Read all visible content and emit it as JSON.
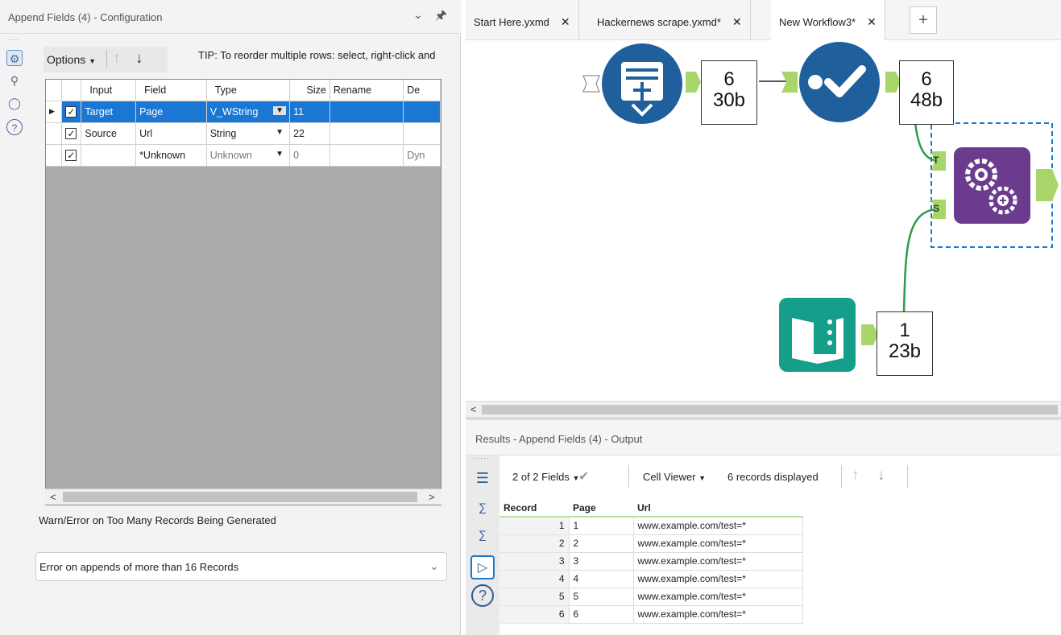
{
  "config_panel": {
    "title": "Append Fields (4) - Configuration",
    "options_label": "Options",
    "tip": "TIP: To reorder multiple rows: select, right-click and",
    "columns": [
      "Input",
      "Field",
      "Type",
      "Size",
      "Rename",
      "De"
    ],
    "rows": [
      {
        "checked": true,
        "input": "Target",
        "field": "Page",
        "type": "V_WString",
        "size": "11",
        "rename": "",
        "desc": "",
        "selected": true
      },
      {
        "checked": true,
        "input": "Source",
        "field": "Url",
        "type": "String",
        "size": "22",
        "rename": "",
        "desc": "",
        "selected": false
      },
      {
        "checked": true,
        "input": "",
        "field": "*Unknown",
        "type": "Unknown",
        "size": "0",
        "rename": "",
        "desc": "Dyn",
        "selected": false
      }
    ],
    "warn_label": "Warn/Error on Too Many Records Being Generated",
    "warn_value": "Error on appends of more than 16 Records"
  },
  "tabs": [
    {
      "label": "Start Here.yxmd",
      "active": false
    },
    {
      "label": "Hackernews scrape.yxmd*",
      "active": false
    },
    {
      "label": "New Workflow3*",
      "active": true
    }
  ],
  "canvas": {
    "box1": {
      "count": "6",
      "size": "30b"
    },
    "box2": {
      "count": "6",
      "size": "48b"
    },
    "box3": {
      "count": "1",
      "size": "23b"
    },
    "anchor_t": "T",
    "anchor_s": "S"
  },
  "results": {
    "title": "Results - Append Fields (4) - Output",
    "fields_label": "2 of 2 Fields",
    "cell_viewer_label": "Cell Viewer",
    "records_displayed": "6 records displayed",
    "columns": [
      "Record",
      "Page",
      "Url"
    ],
    "rows": [
      {
        "record": "1",
        "page": "1",
        "url": "www.example.com/test=*"
      },
      {
        "record": "2",
        "page": "2",
        "url": "www.example.com/test=*"
      },
      {
        "record": "3",
        "page": "3",
        "url": "www.example.com/test=*"
      },
      {
        "record": "4",
        "page": "4",
        "url": "www.example.com/test=*"
      },
      {
        "record": "5",
        "page": "5",
        "url": "www.example.com/test=*"
      },
      {
        "record": "6",
        "page": "6",
        "url": "www.example.com/test=*"
      }
    ]
  },
  "colors": {
    "selection": "#1a78d4",
    "tool_blue": "#1f5f9c",
    "tool_purple": "#6b3c8e",
    "tool_teal": "#159e8a",
    "connector_green": "#a9d66b"
  }
}
